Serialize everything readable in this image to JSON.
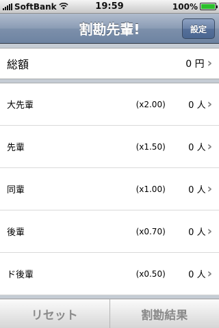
{
  "status_bar": {
    "carrier": "SoftBank",
    "time": "19:59",
    "battery": "100%",
    "battery_level": 1.0
  },
  "nav": {
    "title": "割勘先輩!",
    "settings_label": "設定"
  },
  "total": {
    "label": "総額",
    "value": "0 円"
  },
  "rows": [
    {
      "label": "大先輩",
      "multiplier": "(x2.00)",
      "count": "0 人"
    },
    {
      "label": "先輩",
      "multiplier": "(x1.50)",
      "count": "0 人"
    },
    {
      "label": "同輩",
      "multiplier": "(x1.00)",
      "count": "0 人"
    },
    {
      "label": "後輩",
      "multiplier": "(x0.70)",
      "count": "0 人"
    },
    {
      "label": "ド後輩",
      "multiplier": "(x0.50)",
      "count": "0 人"
    }
  ],
  "toolbar": {
    "reset_label": "リセット",
    "result_label": "割勘結果"
  },
  "icons": {
    "signal": "signal-bars-icon",
    "wifi": "wifi-icon",
    "battery": "battery-icon",
    "chevron": "chevron-right-icon"
  }
}
